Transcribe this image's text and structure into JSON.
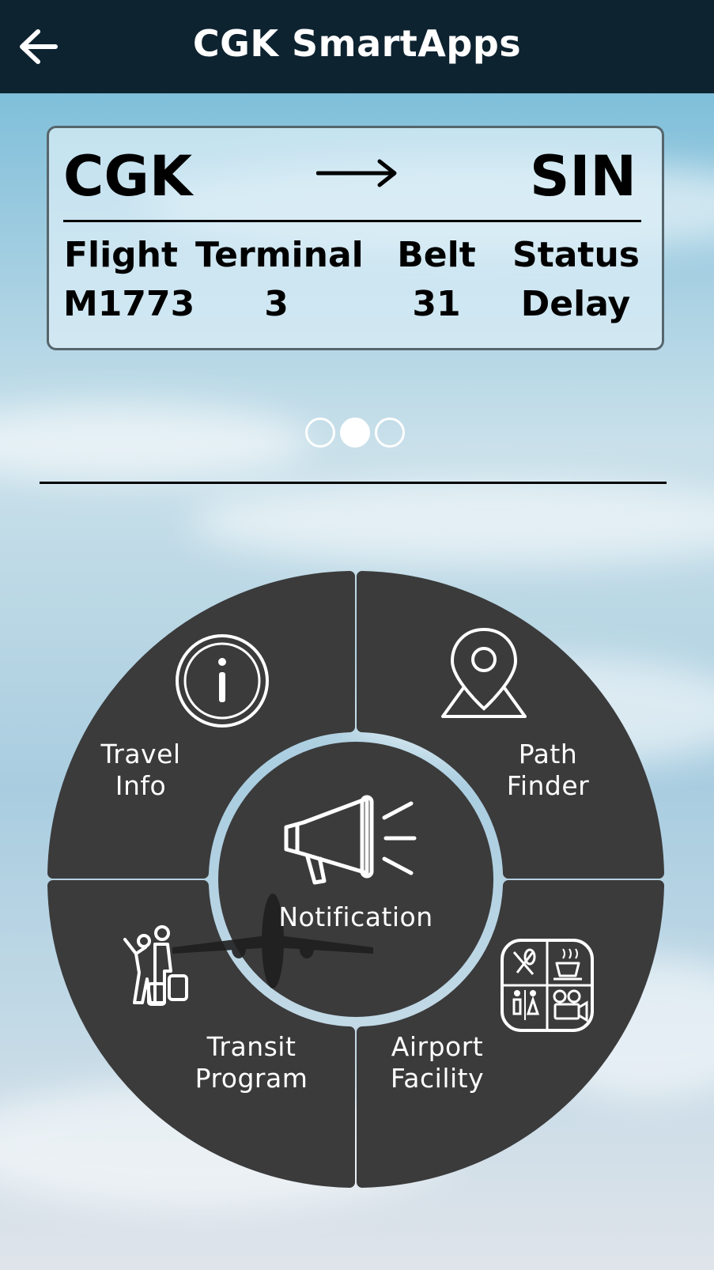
{
  "header": {
    "title": "CGK SmartApps",
    "back_icon": "arrow-left-icon"
  },
  "flight_card": {
    "origin": "CGK",
    "destination": "SIN",
    "arrow_icon": "arrow-right-icon",
    "columns": [
      {
        "header": "Flight",
        "value": "M1773"
      },
      {
        "header": "Terminal",
        "value": "3"
      },
      {
        "header": "Belt",
        "value": "31"
      },
      {
        "header": "Status",
        "value": "Delay"
      }
    ]
  },
  "carousel": {
    "page_count": 3,
    "active_index": 1
  },
  "menu": {
    "travel_info": {
      "line1": "Travel",
      "line2": "Info",
      "icon": "info-icon"
    },
    "path_finder": {
      "line1": "Path",
      "line2": "Finder",
      "icon": "map-pin-icon"
    },
    "transit_program": {
      "line1": "Transit",
      "line2": "Program",
      "icon": "traveler-icon"
    },
    "airport_facility": {
      "line1": "Airport",
      "line2": "Facility",
      "icon": "facilities-icon"
    },
    "notification": {
      "label": "Notification",
      "icon": "megaphone-icon"
    }
  },
  "colors": {
    "header_bg": "#0e2330",
    "segment_bg": "#3b3b3c",
    "text_light": "#ffffff"
  }
}
